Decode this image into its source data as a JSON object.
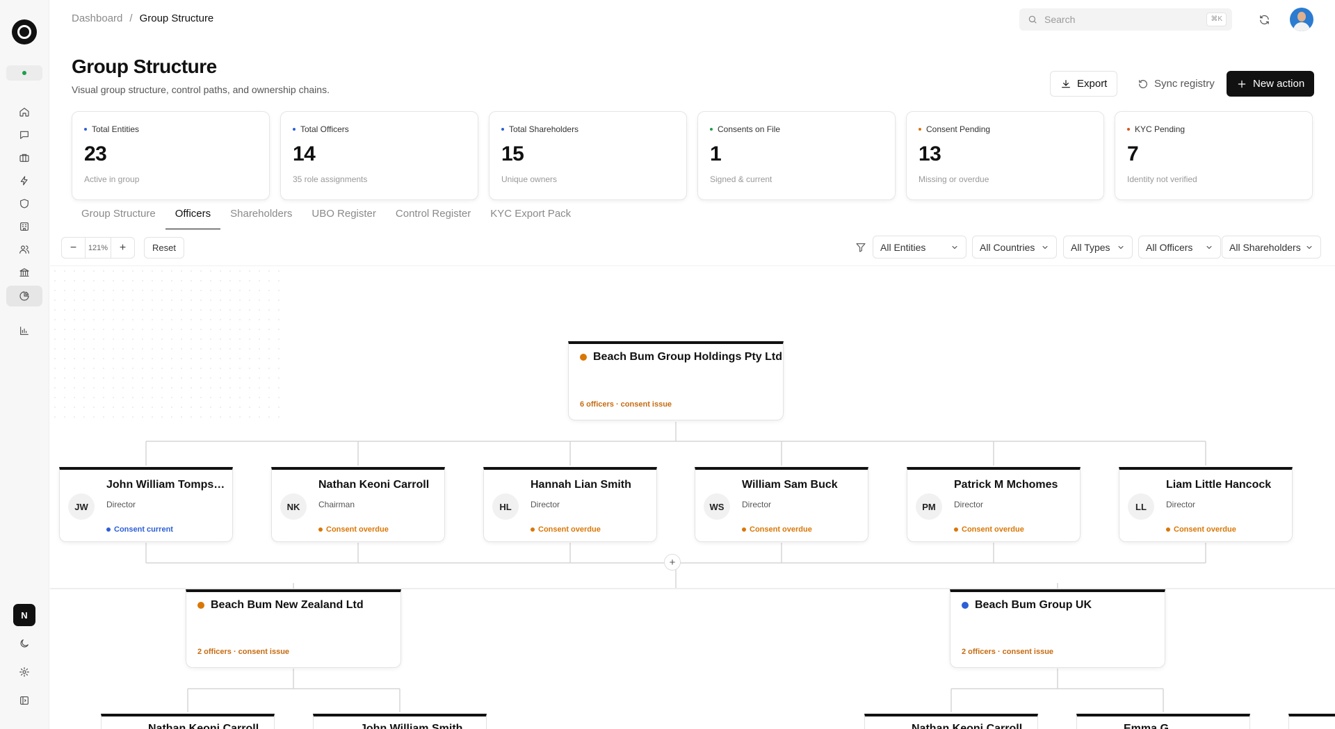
{
  "sidebar": {
    "user_initial": "N"
  },
  "header": {
    "breadcrumb_root": "Dashboard",
    "breadcrumb_sep": "/",
    "breadcrumb_current": "Group Structure",
    "search_placeholder": "Search",
    "search_shortcut": "⌘K"
  },
  "page": {
    "title": "Group Structure",
    "subtitle": "Visual group structure, control paths, and ownership chains."
  },
  "actions": {
    "export": "Export",
    "sync": "Sync registry",
    "new_action": "New action"
  },
  "stats": [
    {
      "label": "Total Entities",
      "value": "23",
      "note": "Active in group",
      "color": "#2d5fd6"
    },
    {
      "label": "Total Officers",
      "value": "14",
      "note": "35 role assignments",
      "color": "#2d5fd6"
    },
    {
      "label": "Total Shareholders",
      "value": "15",
      "note": "Unique owners",
      "color": "#2d5fd6"
    },
    {
      "label": "Consents on File",
      "value": "1",
      "note": "Signed & current",
      "color": "#1e9e4a"
    },
    {
      "label": "Consent Pending",
      "value": "13",
      "note": "Missing or overdue",
      "color": "#d97706"
    },
    {
      "label": "KYC Pending",
      "value": "7",
      "note": "Identity not verified",
      "color": "#d9541e"
    }
  ],
  "tabs": [
    "Group Structure",
    "Officers",
    "Shareholders",
    "UBO Register",
    "Control Register",
    "KYC Export Pack"
  ],
  "active_tab": "Officers",
  "toolbar": {
    "zoom_minus": "−",
    "zoom_value": "121%",
    "zoom_plus": "+",
    "reset": "Reset",
    "filters": [
      "All Entities",
      "All Countries",
      "All Types",
      "All Officers",
      "All Shareholders"
    ]
  },
  "tree": {
    "root": {
      "name": "Beach Bum Group Holdings Pty Ltd",
      "meta": "6 officers · consent issue",
      "dot": "#d97706"
    },
    "officers": [
      {
        "initials": "JW",
        "name": "John William Tompsh...",
        "role": "Director",
        "consent": "Consent current",
        "color": "#2d5fd6"
      },
      {
        "initials": "NK",
        "name": "Nathan Keoni Carroll",
        "role": "Chairman",
        "consent": "Consent overdue",
        "color": "#d97706"
      },
      {
        "initials": "HL",
        "name": "Hannah Lian Smith",
        "role": "Director",
        "consent": "Consent overdue",
        "color": "#d97706"
      },
      {
        "initials": "WS",
        "name": "William Sam Buck",
        "role": "Director",
        "consent": "Consent overdue",
        "color": "#d97706"
      },
      {
        "initials": "PM",
        "name": "Patrick M Mchomes",
        "role": "Director",
        "consent": "Consent overdue",
        "color": "#d97706"
      },
      {
        "initials": "LL",
        "name": "Liam Little Hancock",
        "role": "Director",
        "consent": "Consent overdue",
        "color": "#d97706"
      }
    ],
    "plus": "+",
    "subsidiaries": [
      {
        "name": "Beach Bum New Zealand Ltd",
        "meta": "2 officers · consent issue",
        "dot": "#d97706"
      },
      {
        "name": "Beach Bum Group UK",
        "meta": "2 officers · consent issue",
        "dot": "#2d5fd6"
      }
    ],
    "stubs": [
      "Nathan Keoni Carroll",
      "John William Smith",
      "Nathan Keoni Carroll",
      "Emma G",
      ""
    ]
  }
}
